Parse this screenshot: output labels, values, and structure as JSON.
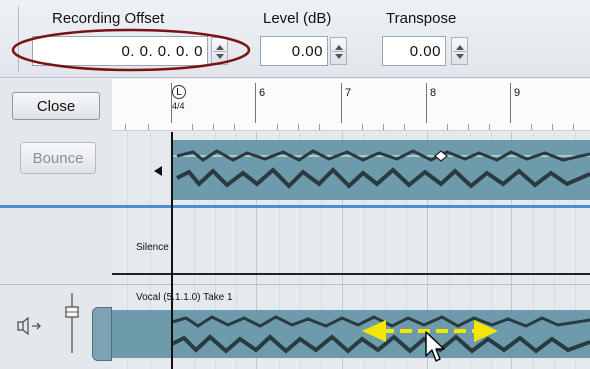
{
  "toolbar": {
    "recording_offset_label": "Recording Offset",
    "recording_offset_value": "0. 0. 0.   0. 0",
    "level_label": "Level (dB)",
    "level_value": "0.00",
    "transpose_label": "Transpose",
    "transpose_value": "0.00"
  },
  "buttons": {
    "close": "Close",
    "bounce": "Bounce"
  },
  "ruler": {
    "start_marker": "L",
    "time_signature": "4/4",
    "bars": [
      "6",
      "7",
      "8",
      "9"
    ]
  },
  "lanes": {
    "silence_label": "Silence",
    "vocal_label": "Vocal (5.1.1.0) Take 1"
  },
  "colors": {
    "waveform_bg": "#6d9bab",
    "waveform": "#2a3a40",
    "annotation_ellipse": "#7a1414",
    "drag_arrow": "#f5e600",
    "selection_line": "#4a8fd6"
  },
  "icons": [
    "spin-up-icon",
    "spin-down-icon",
    "speaker-icon",
    "fader-icon",
    "cursor-arrow-icon",
    "double-arrow-icon"
  ]
}
